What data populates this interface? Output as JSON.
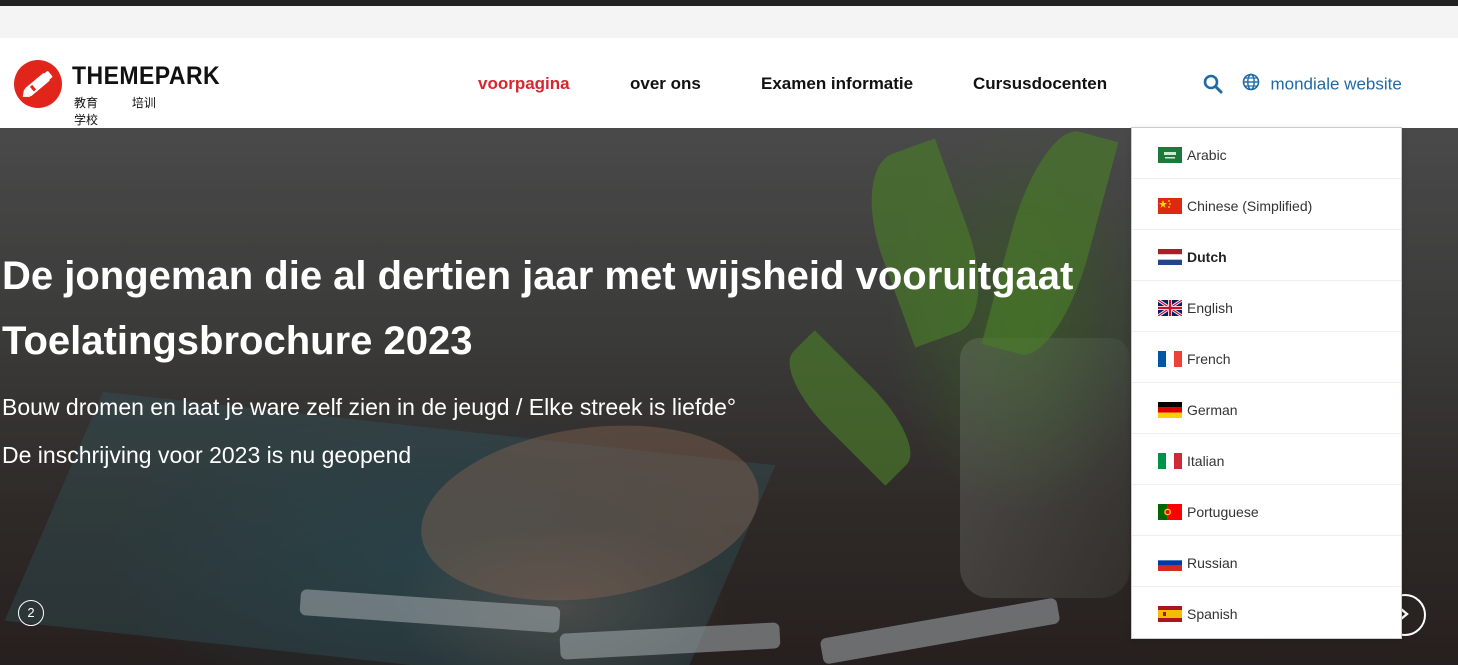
{
  "brand": {
    "name": "THEMEPARK",
    "subtitle": [
      "教育",
      "培训",
      "学校"
    ],
    "accent_color": "#e1251b"
  },
  "nav": {
    "items": [
      {
        "label": "voorpagina",
        "active": true
      },
      {
        "label": "over ons",
        "active": false
      },
      {
        "label": "Examen informatie",
        "active": false
      },
      {
        "label": "Cursusdocenten",
        "active": false
      }
    ],
    "active_color": "#d7262e"
  },
  "header": {
    "search_icon": "search-icon",
    "language_switch_label": "mondiale website",
    "language_icon": "globe-icon"
  },
  "hero": {
    "headline_1": "De jongeman die al dertien jaar met wijsheid vooruitgaat",
    "headline_2": "Toelatingsbrochure 2023",
    "line_1": "Bouw dromen en laat je ware zelf zien in de jeugd / Elke streek is liefde°",
    "line_2": "De inschrijving voor 2023 is nu geopend",
    "slide_indicator": "2"
  },
  "language_dropdown": {
    "selected": "Dutch",
    "options": [
      {
        "label": "Arabic",
        "flag": "saudi-arabia-flag"
      },
      {
        "label": "Chinese (Simplified)",
        "flag": "china-flag"
      },
      {
        "label": "Dutch",
        "flag": "netherlands-flag"
      },
      {
        "label": "English",
        "flag": "uk-flag"
      },
      {
        "label": "French",
        "flag": "france-flag"
      },
      {
        "label": "German",
        "flag": "germany-flag"
      },
      {
        "label": "Italian",
        "flag": "italy-flag"
      },
      {
        "label": "Portuguese",
        "flag": "portugal-flag"
      },
      {
        "label": "Russian",
        "flag": "russia-flag"
      },
      {
        "label": "Spanish",
        "flag": "spain-flag"
      }
    ]
  }
}
